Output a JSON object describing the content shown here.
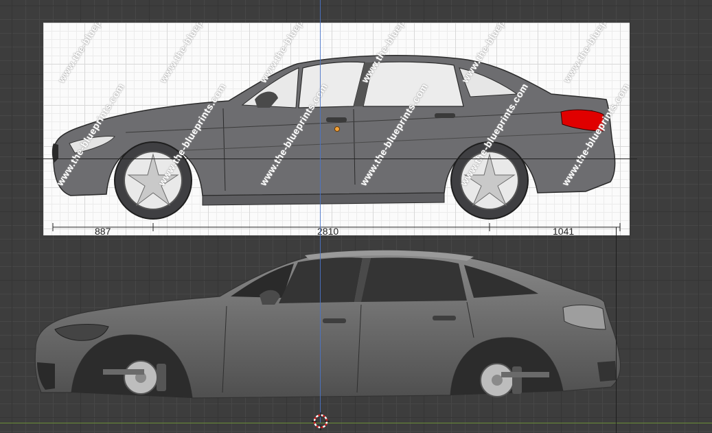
{
  "reference_image": {
    "watermark_text": "www.the-blueprints.com",
    "dimensions": {
      "front_overhang": "887",
      "wheelbase": "2810",
      "rear_overhang": "1041"
    }
  },
  "icons": {
    "origin": "object-origin-dot",
    "cursor": "3d-cursor-icon"
  },
  "colors": {
    "viewport_bg": "#3d3d3d",
    "x_axis": "#6c8f36",
    "y_axis": "#4a74c9",
    "tail_light": "#e00000",
    "origin": "#f2a23a"
  }
}
